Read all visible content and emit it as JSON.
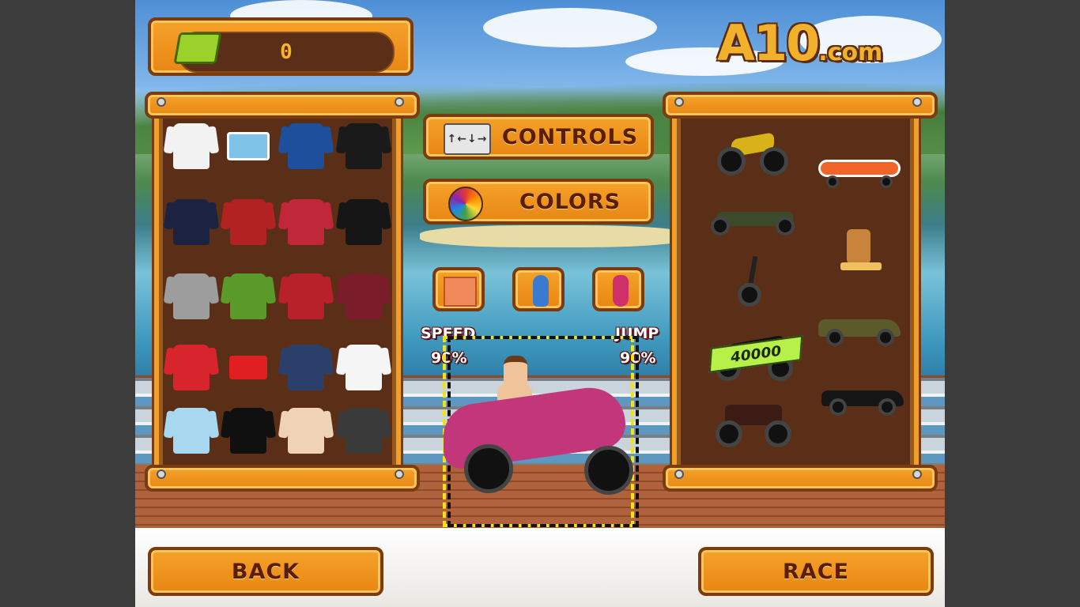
{
  "wallet": {
    "amount": "0",
    "icon": "cash-stack-icon"
  },
  "logo": {
    "brand": "A10",
    "suffix": ".com"
  },
  "buttons": {
    "controls": "CONTROLS",
    "colors": "COLORS",
    "back": "BACK",
    "race": "RACE"
  },
  "stats": {
    "speed_label": "SPEED",
    "speed_value": "90%",
    "jump_label": "JUMP",
    "jump_value": "90%"
  },
  "locked_vehicle": {
    "price": "40000"
  },
  "outfits": [
    {
      "name": "white-tshirt",
      "color": "#f2f2f2"
    },
    {
      "name": "blue-swim-shorts",
      "color": "#7fc4e8"
    },
    {
      "name": "blue-jacket",
      "color": "#1e4f9a"
    },
    {
      "name": "black-leather-jacket",
      "color": "#1a1a1a"
    },
    {
      "name": "navy-hoodie",
      "color": "#1b2340"
    },
    {
      "name": "red-plaid-shirt",
      "color": "#b32222"
    },
    {
      "name": "red-varsity-jacket",
      "color": "#c0283a"
    },
    {
      "name": "black-tuxedo",
      "color": "#161616"
    },
    {
      "name": "grey-suit",
      "color": "#9d9d9d"
    },
    {
      "name": "green-tie-dye-shirt",
      "color": "#5a9a2a"
    },
    {
      "name": "red-jersey-22",
      "color": "#b8202a"
    },
    {
      "name": "maroon-basketball-jersey-03",
      "color": "#7a1c2a"
    },
    {
      "name": "red-vest",
      "color": "#d8242c"
    },
    {
      "name": "red-boxers",
      "color": "#e02020"
    },
    {
      "name": "police-uniform",
      "color": "#2a3f6a"
    },
    {
      "name": "white-elvis-suit",
      "color": "#f5f5f5"
    },
    {
      "name": "light-blue-shirt",
      "color": "#a8d8f0"
    },
    {
      "name": "black-tshirt",
      "color": "#101010"
    },
    {
      "name": "sumo-belly",
      "color": "#f0d2b4"
    },
    {
      "name": "armor-suit",
      "color": "#3a3a3a"
    }
  ]
}
